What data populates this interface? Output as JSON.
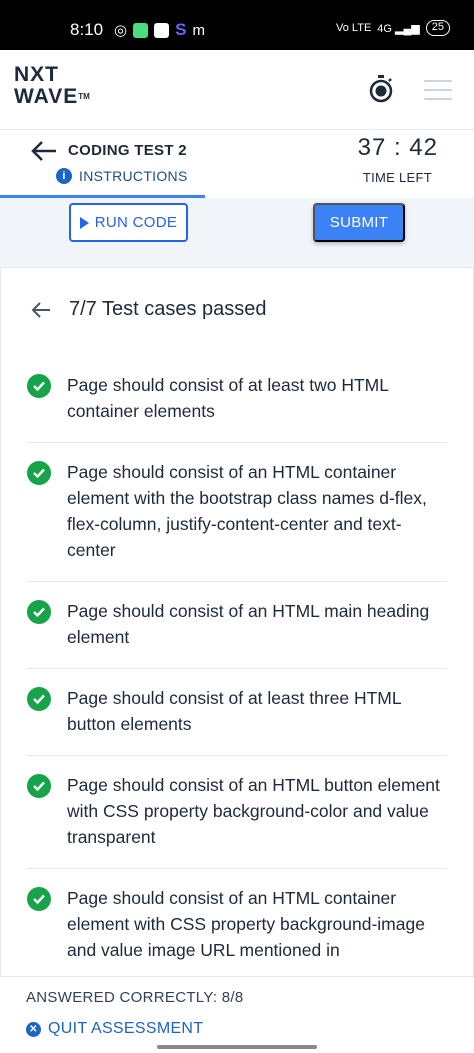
{
  "status_bar": {
    "time": "8:10",
    "network": "Vo LTE",
    "signal": "4G",
    "battery": "25"
  },
  "header": {
    "logo_line1": "NXT",
    "logo_line2": "WAVE",
    "logo_tm": "TM"
  },
  "test": {
    "title": "CODING TEST 2",
    "instructions_label": "INSTRUCTIONS",
    "timer": "37 : 42",
    "timer_label": "TIME LEFT"
  },
  "actions": {
    "run_label": "RUN CODE",
    "submit_label": "SUBMIT"
  },
  "results": {
    "heading": "7/7 Test cases passed",
    "cases": [
      "Page should consist of at least two HTML container elements",
      "Page should consist of an HTML container element with the bootstrap class names d-flex, flex-column, justify-content-center and text-center",
      "Page should consist of an HTML main heading element",
      "Page should consist of at least three HTML button elements",
      "Page should consist of an HTML button element with CSS property background-color and value transparent",
      "Page should consist of an HTML container element with CSS property background-image and value image URL mentioned in"
    ]
  },
  "footer": {
    "answered": "ANSWERED CORRECTLY: 8/8",
    "quit_label": "QUIT ASSESSMENT"
  },
  "colors": {
    "primary": "#3b82f6",
    "success": "#16a34a",
    "link": "#1e63c6"
  }
}
